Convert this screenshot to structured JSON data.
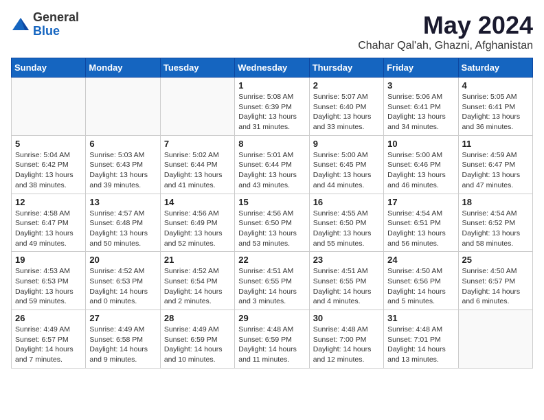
{
  "logo": {
    "general": "General",
    "blue": "Blue"
  },
  "title": "May 2024",
  "location": "Chahar Qal'ah, Ghazni, Afghanistan",
  "weekdays": [
    "Sunday",
    "Monday",
    "Tuesday",
    "Wednesday",
    "Thursday",
    "Friday",
    "Saturday"
  ],
  "weeks": [
    [
      {
        "day": "",
        "info": ""
      },
      {
        "day": "",
        "info": ""
      },
      {
        "day": "",
        "info": ""
      },
      {
        "day": "1",
        "info": "Sunrise: 5:08 AM\nSunset: 6:39 PM\nDaylight: 13 hours and 31 minutes."
      },
      {
        "day": "2",
        "info": "Sunrise: 5:07 AM\nSunset: 6:40 PM\nDaylight: 13 hours and 33 minutes."
      },
      {
        "day": "3",
        "info": "Sunrise: 5:06 AM\nSunset: 6:41 PM\nDaylight: 13 hours and 34 minutes."
      },
      {
        "day": "4",
        "info": "Sunrise: 5:05 AM\nSunset: 6:41 PM\nDaylight: 13 hours and 36 minutes."
      }
    ],
    [
      {
        "day": "5",
        "info": "Sunrise: 5:04 AM\nSunset: 6:42 PM\nDaylight: 13 hours and 38 minutes."
      },
      {
        "day": "6",
        "info": "Sunrise: 5:03 AM\nSunset: 6:43 PM\nDaylight: 13 hours and 39 minutes."
      },
      {
        "day": "7",
        "info": "Sunrise: 5:02 AM\nSunset: 6:44 PM\nDaylight: 13 hours and 41 minutes."
      },
      {
        "day": "8",
        "info": "Sunrise: 5:01 AM\nSunset: 6:44 PM\nDaylight: 13 hours and 43 minutes."
      },
      {
        "day": "9",
        "info": "Sunrise: 5:00 AM\nSunset: 6:45 PM\nDaylight: 13 hours and 44 minutes."
      },
      {
        "day": "10",
        "info": "Sunrise: 5:00 AM\nSunset: 6:46 PM\nDaylight: 13 hours and 46 minutes."
      },
      {
        "day": "11",
        "info": "Sunrise: 4:59 AM\nSunset: 6:47 PM\nDaylight: 13 hours and 47 minutes."
      }
    ],
    [
      {
        "day": "12",
        "info": "Sunrise: 4:58 AM\nSunset: 6:47 PM\nDaylight: 13 hours and 49 minutes."
      },
      {
        "day": "13",
        "info": "Sunrise: 4:57 AM\nSunset: 6:48 PM\nDaylight: 13 hours and 50 minutes."
      },
      {
        "day": "14",
        "info": "Sunrise: 4:56 AM\nSunset: 6:49 PM\nDaylight: 13 hours and 52 minutes."
      },
      {
        "day": "15",
        "info": "Sunrise: 4:56 AM\nSunset: 6:50 PM\nDaylight: 13 hours and 53 minutes."
      },
      {
        "day": "16",
        "info": "Sunrise: 4:55 AM\nSunset: 6:50 PM\nDaylight: 13 hours and 55 minutes."
      },
      {
        "day": "17",
        "info": "Sunrise: 4:54 AM\nSunset: 6:51 PM\nDaylight: 13 hours and 56 minutes."
      },
      {
        "day": "18",
        "info": "Sunrise: 4:54 AM\nSunset: 6:52 PM\nDaylight: 13 hours and 58 minutes."
      }
    ],
    [
      {
        "day": "19",
        "info": "Sunrise: 4:53 AM\nSunset: 6:53 PM\nDaylight: 13 hours and 59 minutes."
      },
      {
        "day": "20",
        "info": "Sunrise: 4:52 AM\nSunset: 6:53 PM\nDaylight: 14 hours and 0 minutes."
      },
      {
        "day": "21",
        "info": "Sunrise: 4:52 AM\nSunset: 6:54 PM\nDaylight: 14 hours and 2 minutes."
      },
      {
        "day": "22",
        "info": "Sunrise: 4:51 AM\nSunset: 6:55 PM\nDaylight: 14 hours and 3 minutes."
      },
      {
        "day": "23",
        "info": "Sunrise: 4:51 AM\nSunset: 6:55 PM\nDaylight: 14 hours and 4 minutes."
      },
      {
        "day": "24",
        "info": "Sunrise: 4:50 AM\nSunset: 6:56 PM\nDaylight: 14 hours and 5 minutes."
      },
      {
        "day": "25",
        "info": "Sunrise: 4:50 AM\nSunset: 6:57 PM\nDaylight: 14 hours and 6 minutes."
      }
    ],
    [
      {
        "day": "26",
        "info": "Sunrise: 4:49 AM\nSunset: 6:57 PM\nDaylight: 14 hours and 7 minutes."
      },
      {
        "day": "27",
        "info": "Sunrise: 4:49 AM\nSunset: 6:58 PM\nDaylight: 14 hours and 9 minutes."
      },
      {
        "day": "28",
        "info": "Sunrise: 4:49 AM\nSunset: 6:59 PM\nDaylight: 14 hours and 10 minutes."
      },
      {
        "day": "29",
        "info": "Sunrise: 4:48 AM\nSunset: 6:59 PM\nDaylight: 14 hours and 11 minutes."
      },
      {
        "day": "30",
        "info": "Sunrise: 4:48 AM\nSunset: 7:00 PM\nDaylight: 14 hours and 12 minutes."
      },
      {
        "day": "31",
        "info": "Sunrise: 4:48 AM\nSunset: 7:01 PM\nDaylight: 14 hours and 13 minutes."
      },
      {
        "day": "",
        "info": ""
      }
    ]
  ]
}
